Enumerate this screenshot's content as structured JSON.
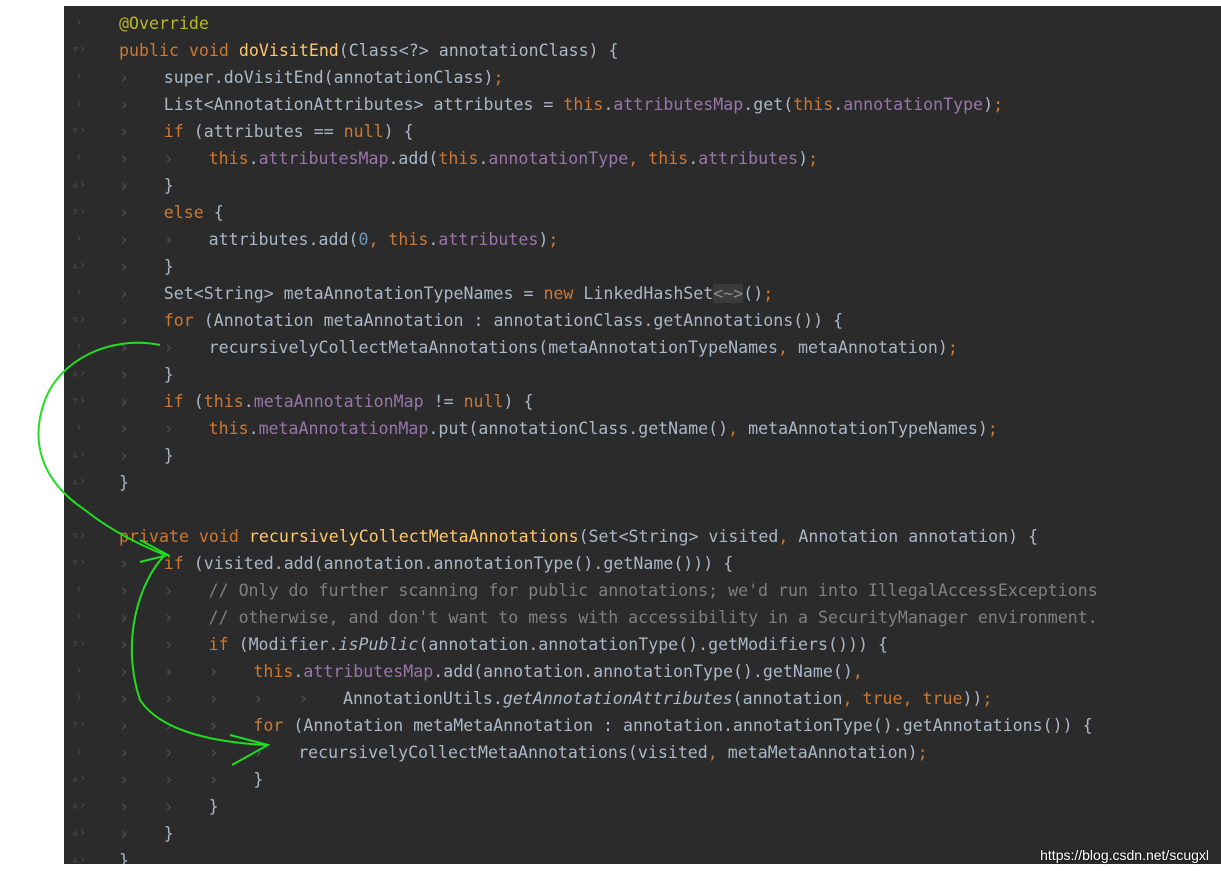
{
  "lines": [
    [
      [
        "ann",
        "@Override"
      ]
    ],
    [
      [
        "kw",
        "public void "
      ],
      [
        "fn",
        "doVisitEnd"
      ],
      [
        "plain",
        "(Class<?> annotationClass) {"
      ]
    ],
    [
      [
        "plain",
        "super"
      ],
      [
        "plain",
        ".doVisitEnd(annotationClass)"
      ],
      [
        "kw",
        ";"
      ]
    ],
    [
      [
        "plain",
        "List<AnnotationAttributes> attributes = "
      ],
      [
        "kw",
        "this"
      ],
      [
        "plain",
        "."
      ],
      [
        "fld",
        "attributesMap"
      ],
      [
        "plain",
        ".get("
      ],
      [
        "kw",
        "this"
      ],
      [
        "plain",
        "."
      ],
      [
        "fld",
        "annotationType"
      ],
      [
        "plain",
        ")"
      ],
      [
        "kw",
        ";"
      ]
    ],
    [
      [
        "kw",
        "if "
      ],
      [
        "plain",
        "(attributes == "
      ],
      [
        "kw",
        "null"
      ],
      [
        "plain",
        ") {"
      ]
    ],
    [
      [
        "kw",
        "this"
      ],
      [
        "plain",
        "."
      ],
      [
        "fld",
        "attributesMap"
      ],
      [
        "plain",
        ".add("
      ],
      [
        "kw",
        "this"
      ],
      [
        "plain",
        "."
      ],
      [
        "fld",
        "annotationType"
      ],
      [
        "kw",
        ", this"
      ],
      [
        "plain",
        "."
      ],
      [
        "fld",
        "attributes"
      ],
      [
        "plain",
        ")"
      ],
      [
        "kw",
        ";"
      ]
    ],
    [
      [
        "plain",
        "}"
      ]
    ],
    [
      [
        "kw",
        "else "
      ],
      [
        "plain",
        "{"
      ]
    ],
    [
      [
        "plain",
        "attributes.add("
      ],
      [
        "num",
        "0"
      ],
      [
        "kw",
        ", this"
      ],
      [
        "plain",
        "."
      ],
      [
        "fld",
        "attributes"
      ],
      [
        "plain",
        ")"
      ],
      [
        "kw",
        ";"
      ]
    ],
    [
      [
        "plain",
        "}"
      ]
    ],
    [
      [
        "plain",
        "Set<String> metaAnnotationTypeNames = "
      ],
      [
        "kw",
        "new "
      ],
      [
        "plain",
        "LinkedHashSet"
      ],
      [
        "diam",
        "<~>"
      ],
      [
        "plain",
        "()"
      ],
      [
        "kw",
        ";"
      ]
    ],
    [
      [
        "kw",
        "for "
      ],
      [
        "plain",
        "(Annotation metaAnnotation : annotationClass.getAnnotations()) {"
      ]
    ],
    [
      [
        "plain",
        "recursivelyCollectMetaAnnotations(metaAnnotationTypeNames"
      ],
      [
        "kw",
        ", "
      ],
      [
        "plain",
        "metaAnnotation)"
      ],
      [
        "kw",
        ";"
      ]
    ],
    [
      [
        "plain",
        "}"
      ]
    ],
    [
      [
        "kw",
        "if "
      ],
      [
        "plain",
        "("
      ],
      [
        "kw",
        "this"
      ],
      [
        "plain",
        "."
      ],
      [
        "fld",
        "metaAnnotationMap"
      ],
      [
        "plain",
        " != "
      ],
      [
        "kw",
        "null"
      ],
      [
        "plain",
        ") {"
      ]
    ],
    [
      [
        "kw",
        "this"
      ],
      [
        "plain",
        "."
      ],
      [
        "fld",
        "metaAnnotationMap"
      ],
      [
        "plain",
        ".put(annotationClass.getName()"
      ],
      [
        "kw",
        ", "
      ],
      [
        "plain",
        "metaAnnotationTypeNames)"
      ],
      [
        "kw",
        ";"
      ]
    ],
    [
      [
        "plain",
        "}"
      ]
    ],
    [
      [
        "plain",
        "}"
      ]
    ],
    [],
    [
      [
        "kw",
        "private void "
      ],
      [
        "fn",
        "recursivelyCollectMetaAnnotations"
      ],
      [
        "plain",
        "(Set<String> visited"
      ],
      [
        "kw",
        ", "
      ],
      [
        "plain",
        "Annotation annotation) {"
      ]
    ],
    [
      [
        "kw",
        "if "
      ],
      [
        "plain",
        "(visited.add(annotation.annotationType().getName())) {"
      ]
    ],
    [
      [
        "cm",
        "// Only do further scanning for public annotations; we'd run into IllegalAccessExceptions"
      ]
    ],
    [
      [
        "cm",
        "// otherwise, and don't want to mess with accessibility in a SecurityManager environment."
      ]
    ],
    [
      [
        "kw",
        "if "
      ],
      [
        "plain",
        "(Modifier."
      ],
      [
        "plain it",
        "isPublic"
      ],
      [
        "plain",
        "(annotation.annotationType().getModifiers())) {"
      ]
    ],
    [
      [
        "kw",
        "this"
      ],
      [
        "plain",
        "."
      ],
      [
        "fld",
        "attributesMap"
      ],
      [
        "plain",
        ".add(annotation.annotationType().getName()"
      ],
      [
        "kw",
        ","
      ]
    ],
    [
      [
        "plain",
        "AnnotationUtils."
      ],
      [
        "plain it",
        "getAnnotationAttributes"
      ],
      [
        "plain",
        "(annotation"
      ],
      [
        "kw",
        ", true, true"
      ],
      [
        "plain",
        "))"
      ],
      [
        "kw",
        ";"
      ]
    ],
    [
      [
        "kw",
        "for "
      ],
      [
        "plain",
        "(Annotation metaMetaAnnotation : annotation.annotationType().getAnnotations()) {"
      ]
    ],
    [
      [
        "plain",
        "recursivelyCollectMetaAnnotations(visited"
      ],
      [
        "kw",
        ", "
      ],
      [
        "plain",
        "metaMetaAnnotation)"
      ],
      [
        "kw",
        ";"
      ]
    ],
    [
      [
        "plain",
        "}"
      ]
    ],
    [
      [
        "plain",
        "}"
      ]
    ],
    [
      [
        "plain",
        "}"
      ]
    ],
    [
      [
        "plain",
        "}"
      ]
    ]
  ],
  "watermark": "https://blog.csdn.net/scugxl"
}
